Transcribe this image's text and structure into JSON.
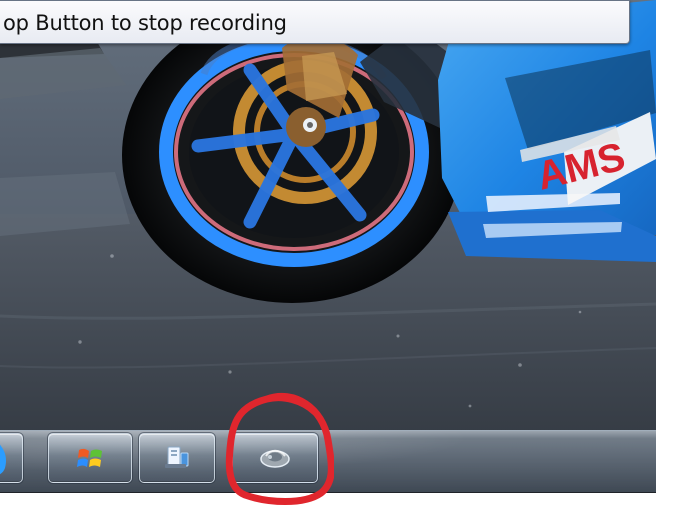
{
  "tooltip": {
    "text": "op Button to stop recording"
  },
  "taskbar": {
    "buttons": [
      {
        "name": "partial-left-button",
        "icon": "blue-blob-icon"
      },
      {
        "name": "windows-button",
        "icon": "windows-logo-icon"
      },
      {
        "name": "windows-explorer-button",
        "icon": "file-explorer-icon"
      },
      {
        "name": "steps-recorder-button",
        "icon": "recorder-icon"
      }
    ]
  },
  "annotation": {
    "color": "#e0262d",
    "shape": "hand-drawn-circle"
  },
  "wallpaper": {
    "subject": "motorcycle-wheel",
    "text": "AMS"
  }
}
